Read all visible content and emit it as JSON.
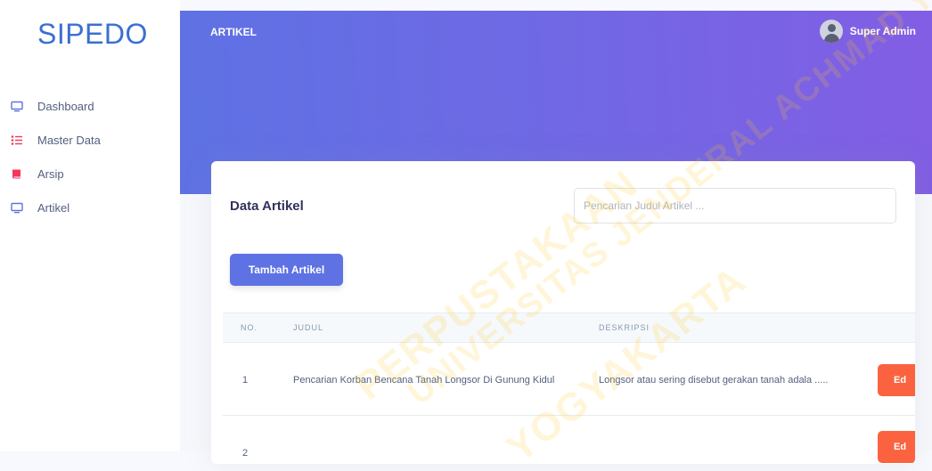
{
  "app": {
    "logo": "SIPEDO"
  },
  "sidebar": {
    "items": [
      {
        "label": "Dashboard",
        "icon": "monitor-icon",
        "color": "#5e72e4"
      },
      {
        "label": "Master Data",
        "icon": "list-icon",
        "color": "#f5365c"
      },
      {
        "label": "Arsip",
        "icon": "book-icon",
        "color": "#f5365c"
      },
      {
        "label": "Artikel",
        "icon": "monitor-icon",
        "color": "#5e72e4"
      }
    ]
  },
  "header": {
    "title": "ARTIKEL",
    "user_name": "Super Admin"
  },
  "card": {
    "title": "Data Artikel",
    "search_placeholder": "Pencarian Judul Artikel ...",
    "add_button": "Tambah Artikel"
  },
  "table": {
    "headers": {
      "no": "NO.",
      "judul": "JUDUL",
      "deskripsi": "DESKRIPSI"
    },
    "rows": [
      {
        "no": "1",
        "judul": "Pencarian Korban Bencana Tanah Longsor Di Gunung Kidul",
        "deskripsi": "Longsor atau sering disebut gerakan tanah adala .....",
        "action": "Ed"
      },
      {
        "no": "2",
        "judul": "",
        "deskripsi": "",
        "action": "Ed"
      }
    ]
  },
  "watermark": {
    "line1": "PERPUSTAKAAN",
    "line2": "UNIVERSITAS JENDERAL ACHMAD YANI",
    "line3": "YOGYAKARTA"
  },
  "colors": {
    "primary": "#5e72e4",
    "gradient_end": "#825ee4",
    "warning": "#fb6340",
    "logo": "#3b6fd1"
  }
}
